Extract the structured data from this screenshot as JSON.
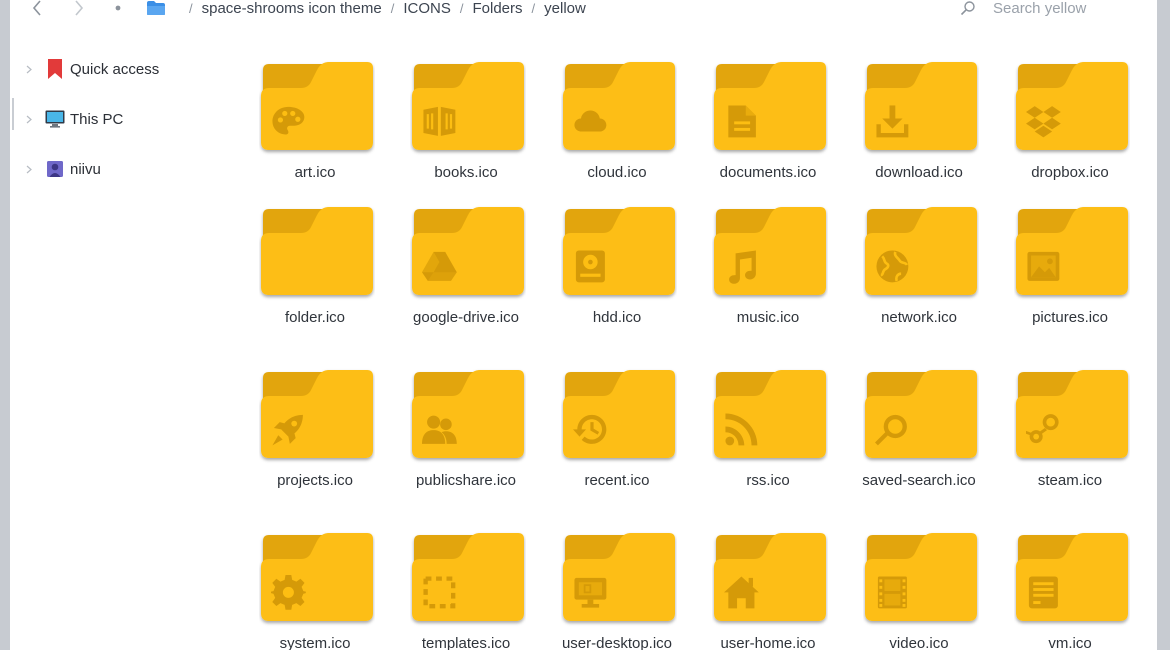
{
  "toolbar": {
    "back_icon": "chevron-left-icon",
    "forward_icon": "chevron-right-icon",
    "recent_icon": "dot-icon"
  },
  "breadcrumb": [
    "space-shrooms icon theme",
    "ICONS",
    "Folders",
    "yellow"
  ],
  "search": {
    "placeholder": "Search yellow"
  },
  "sidebar": {
    "items": [
      {
        "label": "Quick access",
        "icon": "bookmark-icon"
      },
      {
        "label": "This PC",
        "icon": "monitor-icon"
      },
      {
        "label": "niivu",
        "icon": "user-icon"
      }
    ]
  },
  "colors": {
    "folder_body": "#fdbe12",
    "folder_back": "#e2a50a",
    "folder_glyph": "#d59a08",
    "accent_blue": "#3b8fe6",
    "quick_access_red": "#e23a3a"
  },
  "files": [
    {
      "name": "art.ico",
      "icon": "palette-icon"
    },
    {
      "name": "books.ico",
      "icon": "book-icon"
    },
    {
      "name": "cloud.ico",
      "icon": "cloud-icon"
    },
    {
      "name": "documents.ico",
      "icon": "document-icon"
    },
    {
      "name": "download.ico",
      "icon": "download-icon"
    },
    {
      "name": "dropbox.ico",
      "icon": "dropbox-icon"
    },
    {
      "name": "folder.ico",
      "icon": "folder-icon"
    },
    {
      "name": "google-drive.ico",
      "icon": "google-drive-icon"
    },
    {
      "name": "hdd.ico",
      "icon": "hdd-icon"
    },
    {
      "name": "music.ico",
      "icon": "music-note-icon"
    },
    {
      "name": "network.ico",
      "icon": "globe-icon"
    },
    {
      "name": "pictures.ico",
      "icon": "picture-icon"
    },
    {
      "name": "projects.ico",
      "icon": "rocket-icon"
    },
    {
      "name": "publicshare.ico",
      "icon": "users-icon"
    },
    {
      "name": "recent.ico",
      "icon": "history-icon"
    },
    {
      "name": "rss.ico",
      "icon": "rss-icon"
    },
    {
      "name": "saved-search.ico",
      "icon": "magnifier-icon"
    },
    {
      "name": "steam.ico",
      "icon": "steam-icon"
    },
    {
      "name": "system.ico",
      "icon": "gear-icon"
    },
    {
      "name": "templates.ico",
      "icon": "dashed-square-icon"
    },
    {
      "name": "user-desktop.ico",
      "icon": "monitor-icon"
    },
    {
      "name": "user-home.ico",
      "icon": "home-icon"
    },
    {
      "name": "video.ico",
      "icon": "film-icon"
    },
    {
      "name": "vm.ico",
      "icon": "server-icon"
    }
  ]
}
